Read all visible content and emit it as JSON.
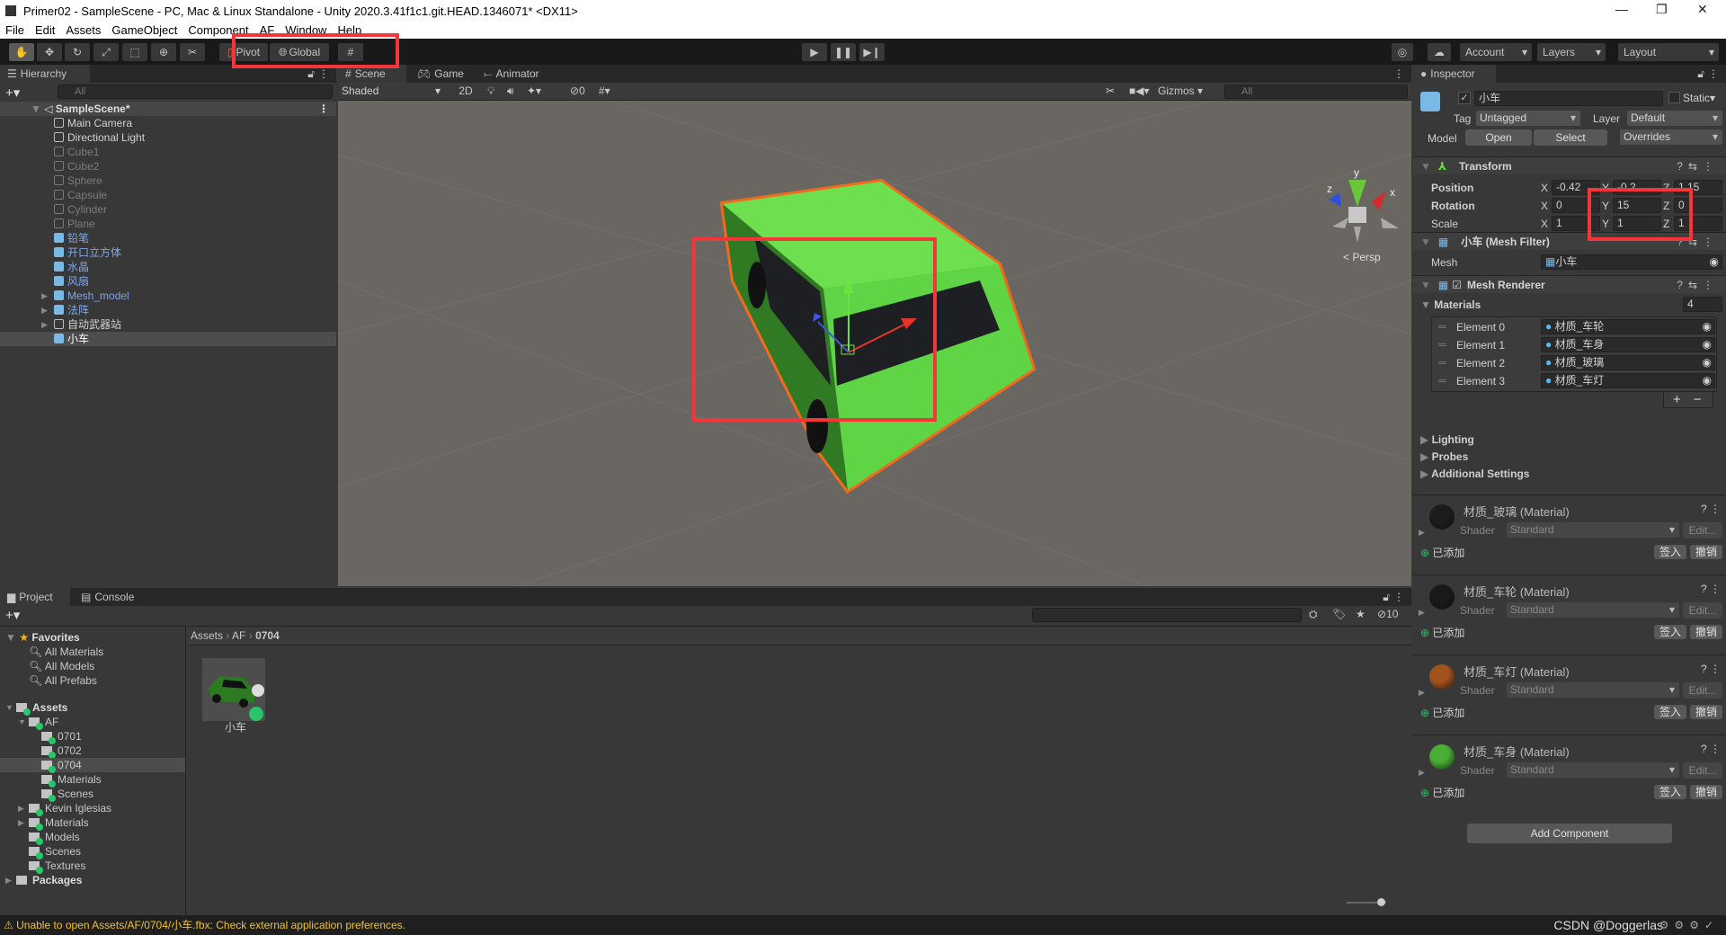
{
  "window": {
    "title": "Primer02 - SampleScene - PC, Mac & Linux Standalone - Unity 2020.3.41f1c1.git.HEAD.1346071* <DX11>",
    "minimize": "—",
    "maximize": "❐",
    "close": "✕"
  },
  "menu": [
    "File",
    "Edit",
    "Assets",
    "GameObject",
    "Component",
    "AF",
    "Window",
    "Help"
  ],
  "toolbar": {
    "pivot": "Pivot",
    "global": "Global",
    "account": "Account",
    "layers": "Layers",
    "layout": "Layout"
  },
  "hierarchy": {
    "tab": "Hierarchy",
    "search_placeholder": "All",
    "scene": "SampleScene*",
    "items": [
      {
        "label": "Main Camera",
        "style": "normal"
      },
      {
        "label": "Directional Light",
        "style": "normal"
      },
      {
        "label": "Cube1",
        "style": "disabled"
      },
      {
        "label": "Cube2",
        "style": "disabled"
      },
      {
        "label": "Sphere",
        "style": "disabled"
      },
      {
        "label": "Capsule",
        "style": "disabled"
      },
      {
        "label": "Cylinder",
        "style": "disabled"
      },
      {
        "label": "Plane",
        "style": "disabled"
      },
      {
        "label": "铅笔",
        "style": "prefab"
      },
      {
        "label": "开口立方体",
        "style": "prefab"
      },
      {
        "label": "水晶",
        "style": "prefab"
      },
      {
        "label": "风扇",
        "style": "prefab"
      },
      {
        "label": "Mesh_model",
        "style": "prefab",
        "expandable": true
      },
      {
        "label": "法阵",
        "style": "prefab",
        "expandable": true
      },
      {
        "label": "自动武器站",
        "style": "normal",
        "expandable": true
      },
      {
        "label": "小车",
        "style": "selected"
      }
    ]
  },
  "scene": {
    "tabs": [
      "Scene",
      "Game",
      "Animator"
    ],
    "shading": "Shaded",
    "mode_2d": "2D",
    "hidden_count": "0",
    "gizmos": "Gizmos",
    "search_placeholder": "All",
    "projection": "Persp",
    "axes": {
      "x": "x",
      "y": "y",
      "z": "z"
    },
    "colors": {
      "car_body": "#6ee04f",
      "outline": "#f26b1d"
    }
  },
  "inspector": {
    "tab": "Inspector",
    "object_name": "小车",
    "static": "Static",
    "tag_label": "Tag",
    "tag": "Untagged",
    "layer_label": "Layer",
    "layer": "Default",
    "model_label": "Model",
    "open": "Open",
    "select": "Select",
    "overrides": "Overrides",
    "transform": {
      "title": "Transform",
      "rows": [
        {
          "label": "Position",
          "x": "-0.42",
          "y": "-0.2",
          "z": "1.15"
        },
        {
          "label": "Rotation",
          "x": "0",
          "y": "15",
          "z": "0"
        },
        {
          "label": "Scale",
          "x": "1",
          "y": "1",
          "z": "1"
        }
      ]
    },
    "mesh_filter": {
      "title": "小车 (Mesh Filter)",
      "mesh_label": "Mesh",
      "mesh": "小车"
    },
    "mesh_renderer": {
      "title": "Mesh Renderer",
      "materials_label": "Materials",
      "count": "4",
      "elements": [
        {
          "label": "Element 0",
          "value": "材质_车轮"
        },
        {
          "label": "Element 1",
          "value": "材质_车身"
        },
        {
          "label": "Element 2",
          "value": "材质_玻璃"
        },
        {
          "label": "Element 3",
          "value": "材质_车灯"
        }
      ],
      "foldouts": [
        "Lighting",
        "Probes",
        "Additional Settings"
      ]
    },
    "materials": [
      {
        "title": "材质_玻璃 (Material)",
        "color": "#1c1c1e"
      },
      {
        "title": "材质_车轮 (Material)",
        "color": "#1a1a1c"
      },
      {
        "title": "材质_车灯 (Material)",
        "color": "#a3521c"
      },
      {
        "title": "材质_车身 (Material)",
        "color": "#4aad35"
      }
    ],
    "shader_label": "Shader",
    "shader": "Standard",
    "edit": "Edit...",
    "added": "已添加",
    "checkin": "签入",
    "revert": "撤销",
    "add_component": "Add Component"
  },
  "project": {
    "tabs": [
      "Project",
      "Console"
    ],
    "hidden_count": "10",
    "breadcrumb": [
      "Assets",
      "AF",
      "0704"
    ],
    "favorites": {
      "label": "Favorites",
      "items": [
        "All Materials",
        "All Models",
        "All Prefabs"
      ]
    },
    "tree": [
      {
        "label": "Assets",
        "depth": 0,
        "bold": true,
        "arrow": "▼"
      },
      {
        "label": "AF",
        "depth": 1,
        "arrow": "▼"
      },
      {
        "label": "0701",
        "depth": 2
      },
      {
        "label": "0702",
        "depth": 2
      },
      {
        "label": "0704",
        "depth": 2,
        "selected": true
      },
      {
        "label": "Materials",
        "depth": 2
      },
      {
        "label": "Scenes",
        "depth": 2
      },
      {
        "label": "Kevin Iglesias",
        "depth": 1,
        "arrow": "▶"
      },
      {
        "label": "Materials",
        "depth": 1,
        "arrow": "▶"
      },
      {
        "label": "Models",
        "depth": 1
      },
      {
        "label": "Scenes",
        "depth": 1
      },
      {
        "label": "Textures",
        "depth": 1
      },
      {
        "label": "Packages",
        "depth": 0,
        "bold": true,
        "arrow": "▶",
        "plain": true
      }
    ],
    "assets": [
      {
        "label": "小车"
      }
    ]
  },
  "status": {
    "message": "Unable to open Assets/AF/0704/小车.fbx: Check external application preferences.",
    "watermark": "CSDN @Doggerlas"
  }
}
